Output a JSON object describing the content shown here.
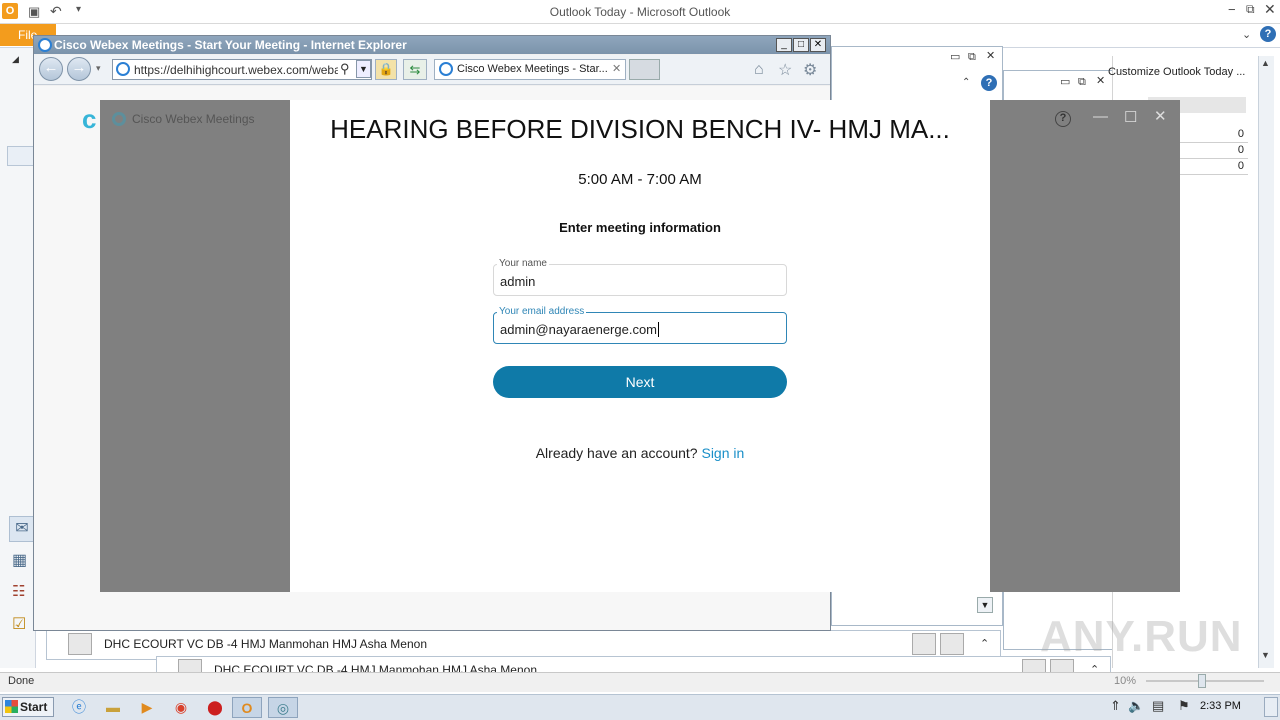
{
  "outlook": {
    "title": "Outlook Today - Microsoft Outlook",
    "file_tab": "File",
    "status": "Done",
    "zoom": "10%",
    "today_title": "Customize Outlook Today ...",
    "today_counts": [
      "0",
      "0",
      "0"
    ],
    "contacts_bar_1": "DHC ECOURT VC DB -4 HMJ Manmohan HMJ Asha Menon",
    "contacts_bar_2": "DHC ECOURT VC DB -4 HMJ Manmohan HMJ Asha Menon"
  },
  "ie": {
    "title": "Cisco Webex Meetings - Start Your Meeting - Internet Explorer",
    "address": "https://delhihighcourt.webex.com/webapp",
    "tab_label": "Cisco Webex Meetings - Star..."
  },
  "webex": {
    "brand": "Cisco Webex Meetings",
    "meeting_title": "HEARING BEFORE DIVISION BENCH IV- HMJ MA...",
    "time": "5:00 AM - 7:00 AM",
    "heading": "Enter meeting information",
    "name_label": "Your name",
    "name_value": "admin",
    "email_label": "Your email address",
    "email_value": "admin@nayaraenerge.com",
    "next": "Next",
    "account_text": "Already have an account?",
    "signin": "Sign in"
  },
  "taskbar": {
    "start": "Start",
    "clock": "2:33 PM"
  },
  "watermark": "ANY.RUN",
  "icons": {
    "back": "back-arrow-icon",
    "forward": "forward-arrow-icon",
    "home": "home-icon",
    "favorites": "star-icon",
    "settings": "gear-icon"
  },
  "colors": {
    "webex_button": "#0f7aa8",
    "webex_link": "#1a8fc8",
    "focus_border": "#2f86b6",
    "dim_overlay": "#808080"
  }
}
